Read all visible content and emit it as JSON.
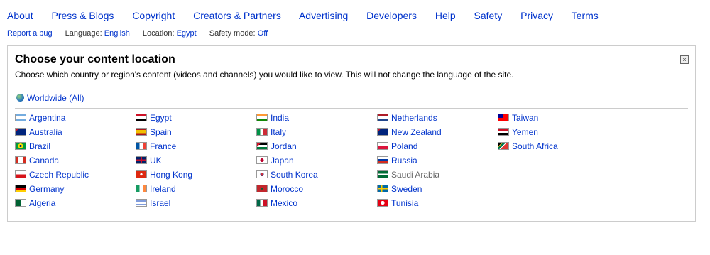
{
  "footer": {
    "links": [
      "About",
      "Press & Blogs",
      "Copyright",
      "Creators & Partners",
      "Advertising",
      "Developers",
      "Help",
      "Safety",
      "Privacy",
      "Terms"
    ]
  },
  "subfooter": {
    "report_bug": "Report a bug",
    "language_label": "Language:",
    "language_value": "English",
    "location_label": "Location:",
    "location_value": "Egypt",
    "safety_label": "Safety mode:",
    "safety_value": "Off"
  },
  "panel": {
    "title": "Choose your content location",
    "description": "Choose which country or region's content (videos and channels) you would like to view. This will not change the language of the site.",
    "close_label": "×",
    "worldwide": "Worldwide (All)"
  },
  "countries": [
    [
      {
        "name": "Argentina",
        "flag": "argentina-flag"
      },
      {
        "name": "Australia",
        "flag": "australia-flag"
      },
      {
        "name": "Brazil",
        "flag": "brazil-flag"
      },
      {
        "name": "Canada",
        "flag": "canada-flag"
      },
      {
        "name": "Czech Republic",
        "flag": "czech-flag"
      },
      {
        "name": "Germany",
        "flag": "germany-flag"
      },
      {
        "name": "Algeria",
        "flag": "algeria-flag"
      }
    ],
    [
      {
        "name": "Egypt",
        "flag": "egypt-flag"
      },
      {
        "name": "Spain",
        "flag": "spain-flag"
      },
      {
        "name": "France",
        "flag": "france-flag"
      },
      {
        "name": "UK",
        "flag": "uk-flag"
      },
      {
        "name": "Hong Kong",
        "flag": "hongkong-flag"
      },
      {
        "name": "Ireland",
        "flag": "ireland-flag"
      },
      {
        "name": "Israel",
        "flag": "israel-flag"
      }
    ],
    [
      {
        "name": "India",
        "flag": "india-flag"
      },
      {
        "name": "Italy",
        "flag": "italy-flag"
      },
      {
        "name": "Jordan",
        "flag": "jordan-flag"
      },
      {
        "name": "Japan",
        "flag": "japan-flag"
      },
      {
        "name": "South Korea",
        "flag": "korea-flag"
      },
      {
        "name": "Morocco",
        "flag": "morocco-flag"
      },
      {
        "name": "Mexico",
        "flag": "mexico-flag"
      }
    ],
    [
      {
        "name": "Netherlands",
        "flag": "netherlands-flag"
      },
      {
        "name": "New Zealand",
        "flag": "newzealand-flag"
      },
      {
        "name": "Poland",
        "flag": "poland-flag"
      },
      {
        "name": "Russia",
        "flag": "russia-flag"
      },
      {
        "name": "Saudi Arabia",
        "flag": "saudi-flag",
        "disabled": true
      },
      {
        "name": "Sweden",
        "flag": "sweden-flag"
      },
      {
        "name": "Tunisia",
        "flag": "tunisia-flag"
      }
    ],
    [
      {
        "name": "Taiwan",
        "flag": "taiwan-flag"
      },
      {
        "name": "Yemen",
        "flag": "yemen-flag"
      },
      {
        "name": "South Africa",
        "flag": "southafrica-flag"
      }
    ]
  ],
  "colors": {
    "link": "#0033cc",
    "disabled": "#666666",
    "border": "#cccccc"
  }
}
